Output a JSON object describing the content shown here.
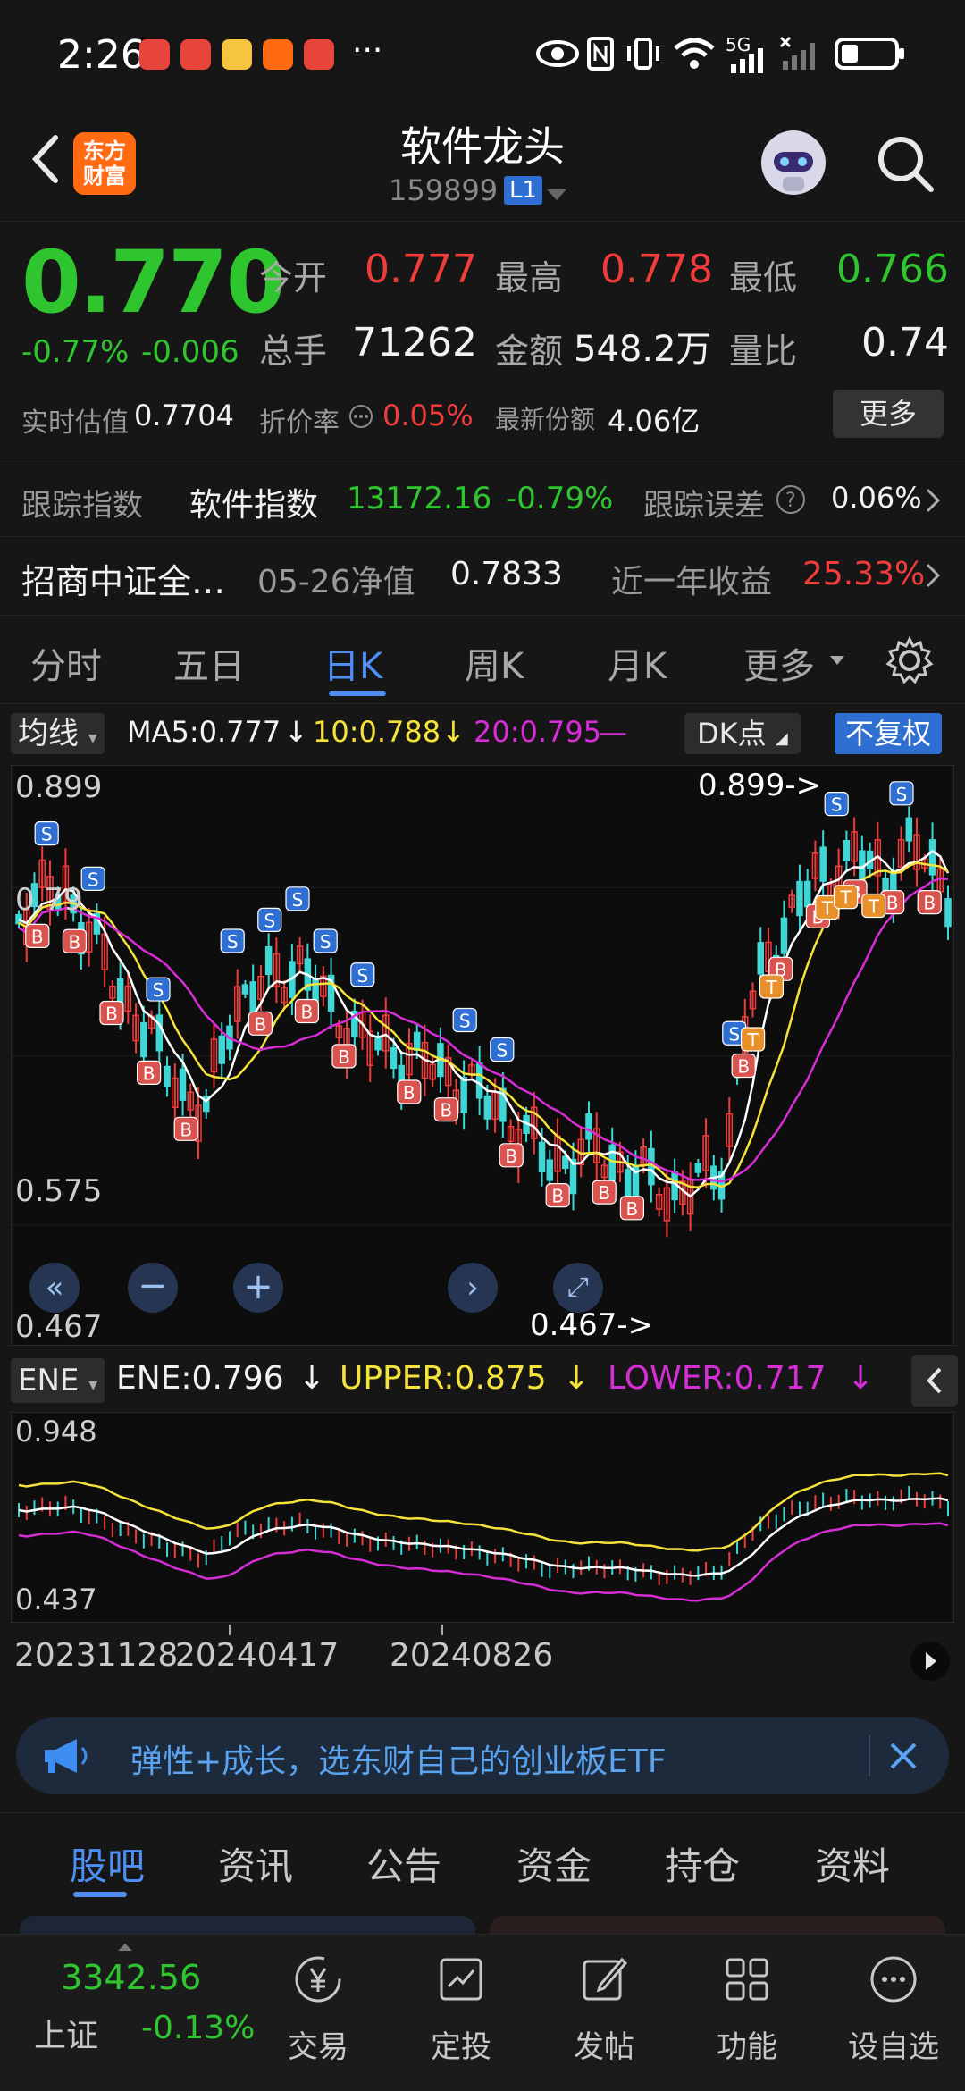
{
  "status": {
    "time": "2:26",
    "network": "5G"
  },
  "header": {
    "logo_text": "东方财富",
    "title": "软件龙头",
    "code": "159899",
    "level": "L1"
  },
  "quote": {
    "price": "0.770",
    "change_pct": "-0.77%",
    "change_abs": "-0.006",
    "open_label": "今开",
    "open": "0.777",
    "high_label": "最高",
    "high": "0.778",
    "low_label": "最低",
    "low": "0.766",
    "volume_label": "总手",
    "volume": "71262",
    "amount_label": "金额",
    "amount": "548.2万",
    "vol_ratio_label": "量比",
    "vol_ratio": "0.74",
    "iopv_label": "实时估值",
    "iopv": "0.7704",
    "discount_label": "折价率",
    "discount": "0.05%",
    "shares_label": "最新份额",
    "shares": "4.06亿",
    "more_label": "更多"
  },
  "tracking": {
    "label": "跟踪指数",
    "index_name": "软件指数",
    "index_value": "13172.16",
    "index_change": "-0.79%",
    "error_label": "跟踪误差",
    "error_value": "0.06%",
    "fund_name": "招商中证全…",
    "nav_label": "05-26净值",
    "nav_value": "0.7833",
    "return_label": "近一年收益",
    "return_value": "25.33%"
  },
  "period_tabs": [
    "分时",
    "五日",
    "日K",
    "周K",
    "月K",
    "更多"
  ],
  "active_period": "日K",
  "ma_legend": {
    "toggle": "均线",
    "ma5": "MA5:0.777",
    "ma10": "10:0.788",
    "ma20": "20:0.795",
    "dk_label": "DK点",
    "adjust_label": "不复权",
    "colors": {
      "ma5": "#ffffff",
      "ma10": "#f5e23a",
      "ma20": "#d62dd6",
      "up": "#f23c3c",
      "down": "#3fd6d6"
    }
  },
  "kline_axis": {
    "top": "0.899",
    "mid1": "0.79",
    "mid2": "0.575",
    "bottom": "0.467",
    "max_marker": "0.899->",
    "min_marker": "0.467->"
  },
  "ene_legend": {
    "toggle": "ENE",
    "ene": "ENE:0.796",
    "upper": "UPPER:0.875",
    "lower": "LOWER:0.717"
  },
  "ene_axis": {
    "top": "0.948",
    "bottom": "0.437"
  },
  "dates": [
    "20231128",
    "20240417",
    "20240826"
  ],
  "banner": {
    "text": "弹性+成长，选东财自己的创业板ETF"
  },
  "content_tabs": [
    "股吧",
    "资讯",
    "公告",
    "资金",
    "持仓",
    "资料"
  ],
  "active_content_tab": "股吧",
  "bottom_nav": {
    "index_value": "3342.56",
    "index_name": "上证",
    "index_change": "-0.13%",
    "items": [
      "交易",
      "定投",
      "发帖",
      "功能",
      "设自选"
    ]
  },
  "chart_data": {
    "type": "line",
    "x": [
      "20231128",
      "20240417",
      "20240826"
    ],
    "ylim": [
      0.467,
      0.899
    ],
    "series": [
      {
        "name": "MA5",
        "values": [
          0.777
        ]
      },
      {
        "name": "10",
        "values": [
          0.788
        ]
      },
      {
        "name": "20",
        "values": [
          0.795
        ]
      }
    ]
  }
}
